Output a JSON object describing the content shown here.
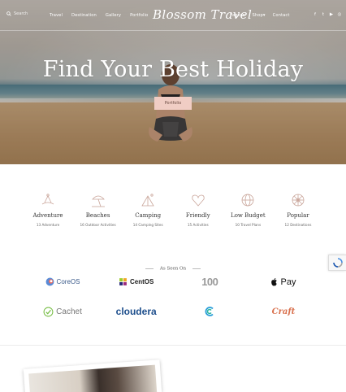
{
  "nav": {
    "search_label": "Search",
    "left_items": [
      "Travel",
      "Destination",
      "Gallery",
      "Portfolio"
    ],
    "logo": "Blossom Travel",
    "right_items": [
      "Pages▾",
      "Shop▾",
      "Contact"
    ],
    "social_icons": [
      "facebook-icon",
      "twitter-icon",
      "youtube-icon",
      "instagram-icon"
    ]
  },
  "hero": {
    "title": "Find Your Best Holiday",
    "button_label": "Portfolio"
  },
  "activities": [
    {
      "icon": "adventure-icon",
      "title": "Adventure",
      "subtitle": "13 Adventure"
    },
    {
      "icon": "beach-umbrella-icon",
      "title": "Beaches",
      "subtitle": "16 Outdoor Activities"
    },
    {
      "icon": "camping-tent-icon",
      "title": "Camping",
      "subtitle": "14 Camping Sites"
    },
    {
      "icon": "friendly-heart-icon",
      "title": "Friendly",
      "subtitle": "15 Activities"
    },
    {
      "icon": "low-budget-globe-icon",
      "title": "Low Budget",
      "subtitle": "10 Travel Plans"
    },
    {
      "icon": "popular-wheel-icon",
      "title": "Popular",
      "subtitle": "12 Destinations"
    }
  ],
  "seen_on": {
    "label": "As Seen On",
    "row1": [
      "CoreOS",
      "CentOS",
      "100",
      "Pay"
    ],
    "row2": [
      "Cachet",
      "cloudera",
      "",
      "Craft"
    ]
  },
  "colors": {
    "accent": "#f0cdc4",
    "icon_stroke": "#c9a59a"
  }
}
